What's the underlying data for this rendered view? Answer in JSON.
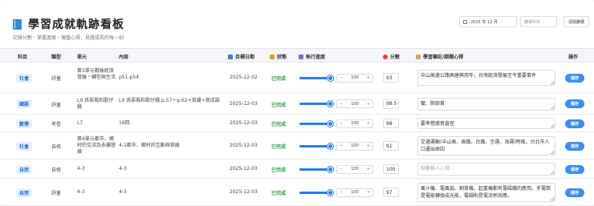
{
  "header": {
    "title": "學習成就軌跡看板",
    "subtitle": "記錄分數・掌握進度・複盤心得，見證成長的每一刻"
  },
  "filters": {
    "month_value": "2025 年 12 月",
    "subject_placeholder": "篩選科目",
    "clear_label": "清除篩選"
  },
  "table": {
    "columns": {
      "subject": "科目",
      "type": "類型",
      "unit": "單元",
      "content": "內容",
      "target_date": "目標日期",
      "status": "狀態",
      "progress": "執行進度",
      "score": "分數",
      "notes": "學習筆記/錯題心得",
      "actions": "操作"
    },
    "save_label": "儲存",
    "note_placeholder": "點擊輸入心得...",
    "rows": [
      {
        "subject": "社會",
        "type": "評量",
        "unit": "第3單元戰後經濟發展・轉型與生活",
        "content": "p51-p54",
        "date": "2025-12-02",
        "status": "已完成",
        "progress": 100,
        "stepper": "100",
        "score": "93",
        "note": "中山高速公路興建興用年，台灣經濟發展至今重要事件"
      },
      {
        "subject": "國語",
        "type": "評量",
        "unit": "L9 孫翠鳳和歌仔戲",
        "content": "L9 孫翠鳳和歌仔戲 p.57～p.62+背誦+寫成語",
        "date": "2025-12-03",
        "status": "已完成",
        "progress": 100,
        "stepper": "100",
        "score": "98.5",
        "note": "鸞、肺部首"
      },
      {
        "subject": "數學",
        "type": "考卷",
        "unit": "L7",
        "content": "16回",
        "date": "2025-12-03",
        "status": "已完成",
        "progress": 100,
        "stepper": "100",
        "score": "98",
        "note": "要率借據寫直徑"
      },
      {
        "subject": "社會",
        "type": "自修",
        "unit": "第4單元都市、鄉村的交流及永續發展",
        "content": "4-1都市、鄉村的互動與發展",
        "date": "2025-12-03",
        "status": "已完成",
        "progress": 100,
        "stepper": "100",
        "score": "91",
        "note": "交通運輸(中山高、高鐵、台鐵、空運、海運)時做，台北市人口遷出原因"
      },
      {
        "subject": "自然",
        "type": "自修",
        "unit": "4-3",
        "content": "4-3",
        "date": "2025-12-03",
        "status": "已完成",
        "progress": 100,
        "stepper": "100",
        "score": "100",
        "note": ""
      },
      {
        "subject": "自然",
        "type": "評量",
        "unit": "4-3",
        "content": "4-3",
        "date": "2025-12-03",
        "status": "已完成",
        "progress": 100,
        "stepper": "100",
        "score": "97",
        "note": "果汁機、電風扇、割草機，起重機都有電磁鐵的應用。手電筒是電能轉換成光能，電鍋則是電流熱效應。"
      }
    ]
  },
  "colors": {
    "accent": "#2b7de9",
    "status_done": "#2e9d44",
    "badge_bg": "#e5f0fd"
  }
}
